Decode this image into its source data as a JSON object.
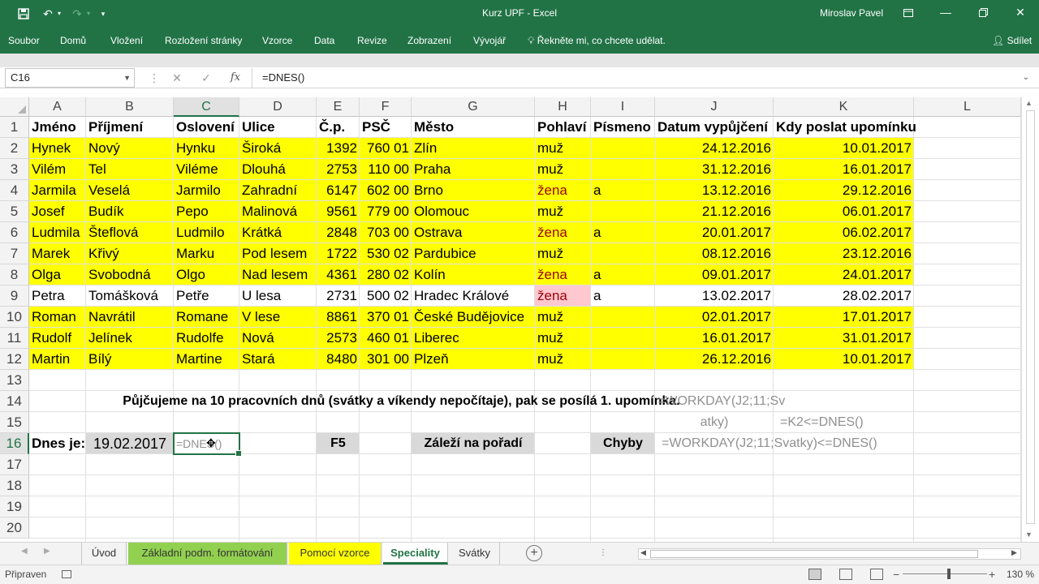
{
  "window": {
    "title": "Kurz UPF  -  Excel",
    "user": "Miroslav Pavel",
    "icons": [
      "save-icon",
      "undo-icon",
      "redo-icon",
      "customize-icon",
      "ribbon-display-icon",
      "minimize-icon",
      "restore-icon",
      "close-icon"
    ]
  },
  "ribbon": {
    "tabs": [
      "Soubor",
      "Domů",
      "Vložení",
      "Rozložení stránky",
      "Vzorce",
      "Data",
      "Revize",
      "Zobrazení",
      "Vývojář"
    ],
    "tell_me": "Řekněte mi, co chcete udělat.",
    "share": "Sdílet"
  },
  "formula_bar": {
    "name_box": "C16",
    "formula": "=DNES()"
  },
  "columns": [
    "A",
    "B",
    "C",
    "D",
    "E",
    "F",
    "G",
    "H",
    "I",
    "J",
    "K",
    "L"
  ],
  "selected_column": "C",
  "rows": [
    "1",
    "2",
    "3",
    "4",
    "5",
    "6",
    "7",
    "8",
    "9",
    "10",
    "11",
    "12",
    "13",
    "14",
    "15",
    "16",
    "17",
    "18",
    "19",
    "20"
  ],
  "selected_row": "16",
  "colors": {
    "accent": "#217346",
    "yellow_fill": "#ffff00",
    "pink_fill": "#ffc7ce",
    "red_text": "#9c0006",
    "gray_fill": "#d9d9d9"
  },
  "header_row": [
    "Jméno",
    "Příjmení",
    "Oslovení",
    "Ulice",
    "Č.p.",
    "PSČ",
    "Město",
    "Pohlaví",
    "Písmeno",
    "Datum vypůjčení",
    "Kdy poslat upomínku"
  ],
  "data_rows": [
    [
      "Hynek",
      "Nový",
      "Hynku",
      "Široká",
      "1392",
      "760 01",
      "Zlín",
      "muž",
      "",
      "24.12.2016",
      "10.01.2017"
    ],
    [
      "Vilém",
      "Tel",
      "Viléme",
      "Dlouhá",
      "2753",
      "110 00",
      "Praha",
      "muž",
      "",
      "31.12.2016",
      "16.01.2017"
    ],
    [
      "Jarmila",
      "Veselá",
      "Jarmilo",
      "Zahradní",
      "6147",
      "602 00",
      "Brno",
      "žena",
      "a",
      "13.12.2016",
      "29.12.2016"
    ],
    [
      "Josef",
      "Budík",
      "Pepo",
      "Malinová",
      "9561",
      "779 00",
      "Olomouc",
      "muž",
      "",
      "21.12.2016",
      "06.01.2017"
    ],
    [
      "Ludmila",
      "Šteflová",
      "Ludmilo",
      "Krátká",
      "2848",
      "703 00",
      "Ostrava",
      "žena",
      "a",
      "20.01.2017",
      "06.02.2017"
    ],
    [
      "Marek",
      "Křivý",
      "Marku",
      "Pod lesem",
      "1722",
      "530 02",
      "Pardubice",
      "muž",
      "",
      "08.12.2016",
      "23.12.2016"
    ],
    [
      "Olga",
      "Svobodná",
      "Olgo",
      "Nad lesem",
      "4361",
      "280 02",
      "Kolín",
      "žena",
      "a",
      "09.01.2017",
      "24.01.2017"
    ],
    [
      "Petra",
      "Tomášková",
      "Petře",
      "U lesa",
      "2731",
      "500 02",
      "Hradec Králové",
      "žena",
      "a",
      "13.02.2017",
      "28.02.2017"
    ],
    [
      "Roman",
      "Navrátil",
      "Romane",
      "V lese",
      "8861",
      "370 01",
      "České Budějovice",
      "muž",
      "",
      "02.01.2017",
      "17.01.2017"
    ],
    [
      "Rudolf",
      "Jelínek",
      "Rudolfe",
      "Nová",
      "2573",
      "460 01",
      "Liberec",
      "muž",
      "",
      "16.01.2017",
      "31.01.2017"
    ],
    [
      "Martin",
      "Bílý",
      "Martine",
      "Stará",
      "8480",
      "301 00",
      "Plzeň",
      "muž",
      "",
      "26.12.2016",
      "10.01.2017"
    ]
  ],
  "notes": {
    "row14": "Půjčujeme na 10 pracovních dnů (svátky a víkendy nepočítaje), pak se posílá 1. upomínka.",
    "j14_line1": "=WORKDAY(J2;11;Sv",
    "j15_line2": "atky)",
    "k15": "=K2<=DNES()",
    "a16": "Dnes je:",
    "b16": "19.02.2017",
    "c16": "=DNES()",
    "e16": "F5",
    "g16": "Záleží na pořadí",
    "i16": "Chyby",
    "j16": "=WORKDAY(J2;11;Svatky)<=DNES()"
  },
  "sheet_tabs": {
    "items": [
      "Úvod",
      "Základní podm. formátování",
      "Pomocí vzorce",
      "Speciality",
      "Svátky"
    ],
    "active": "Speciality"
  },
  "status_bar": {
    "ready": "Připraven",
    "zoom_percent": 130,
    "zoom_label": "130 %"
  }
}
